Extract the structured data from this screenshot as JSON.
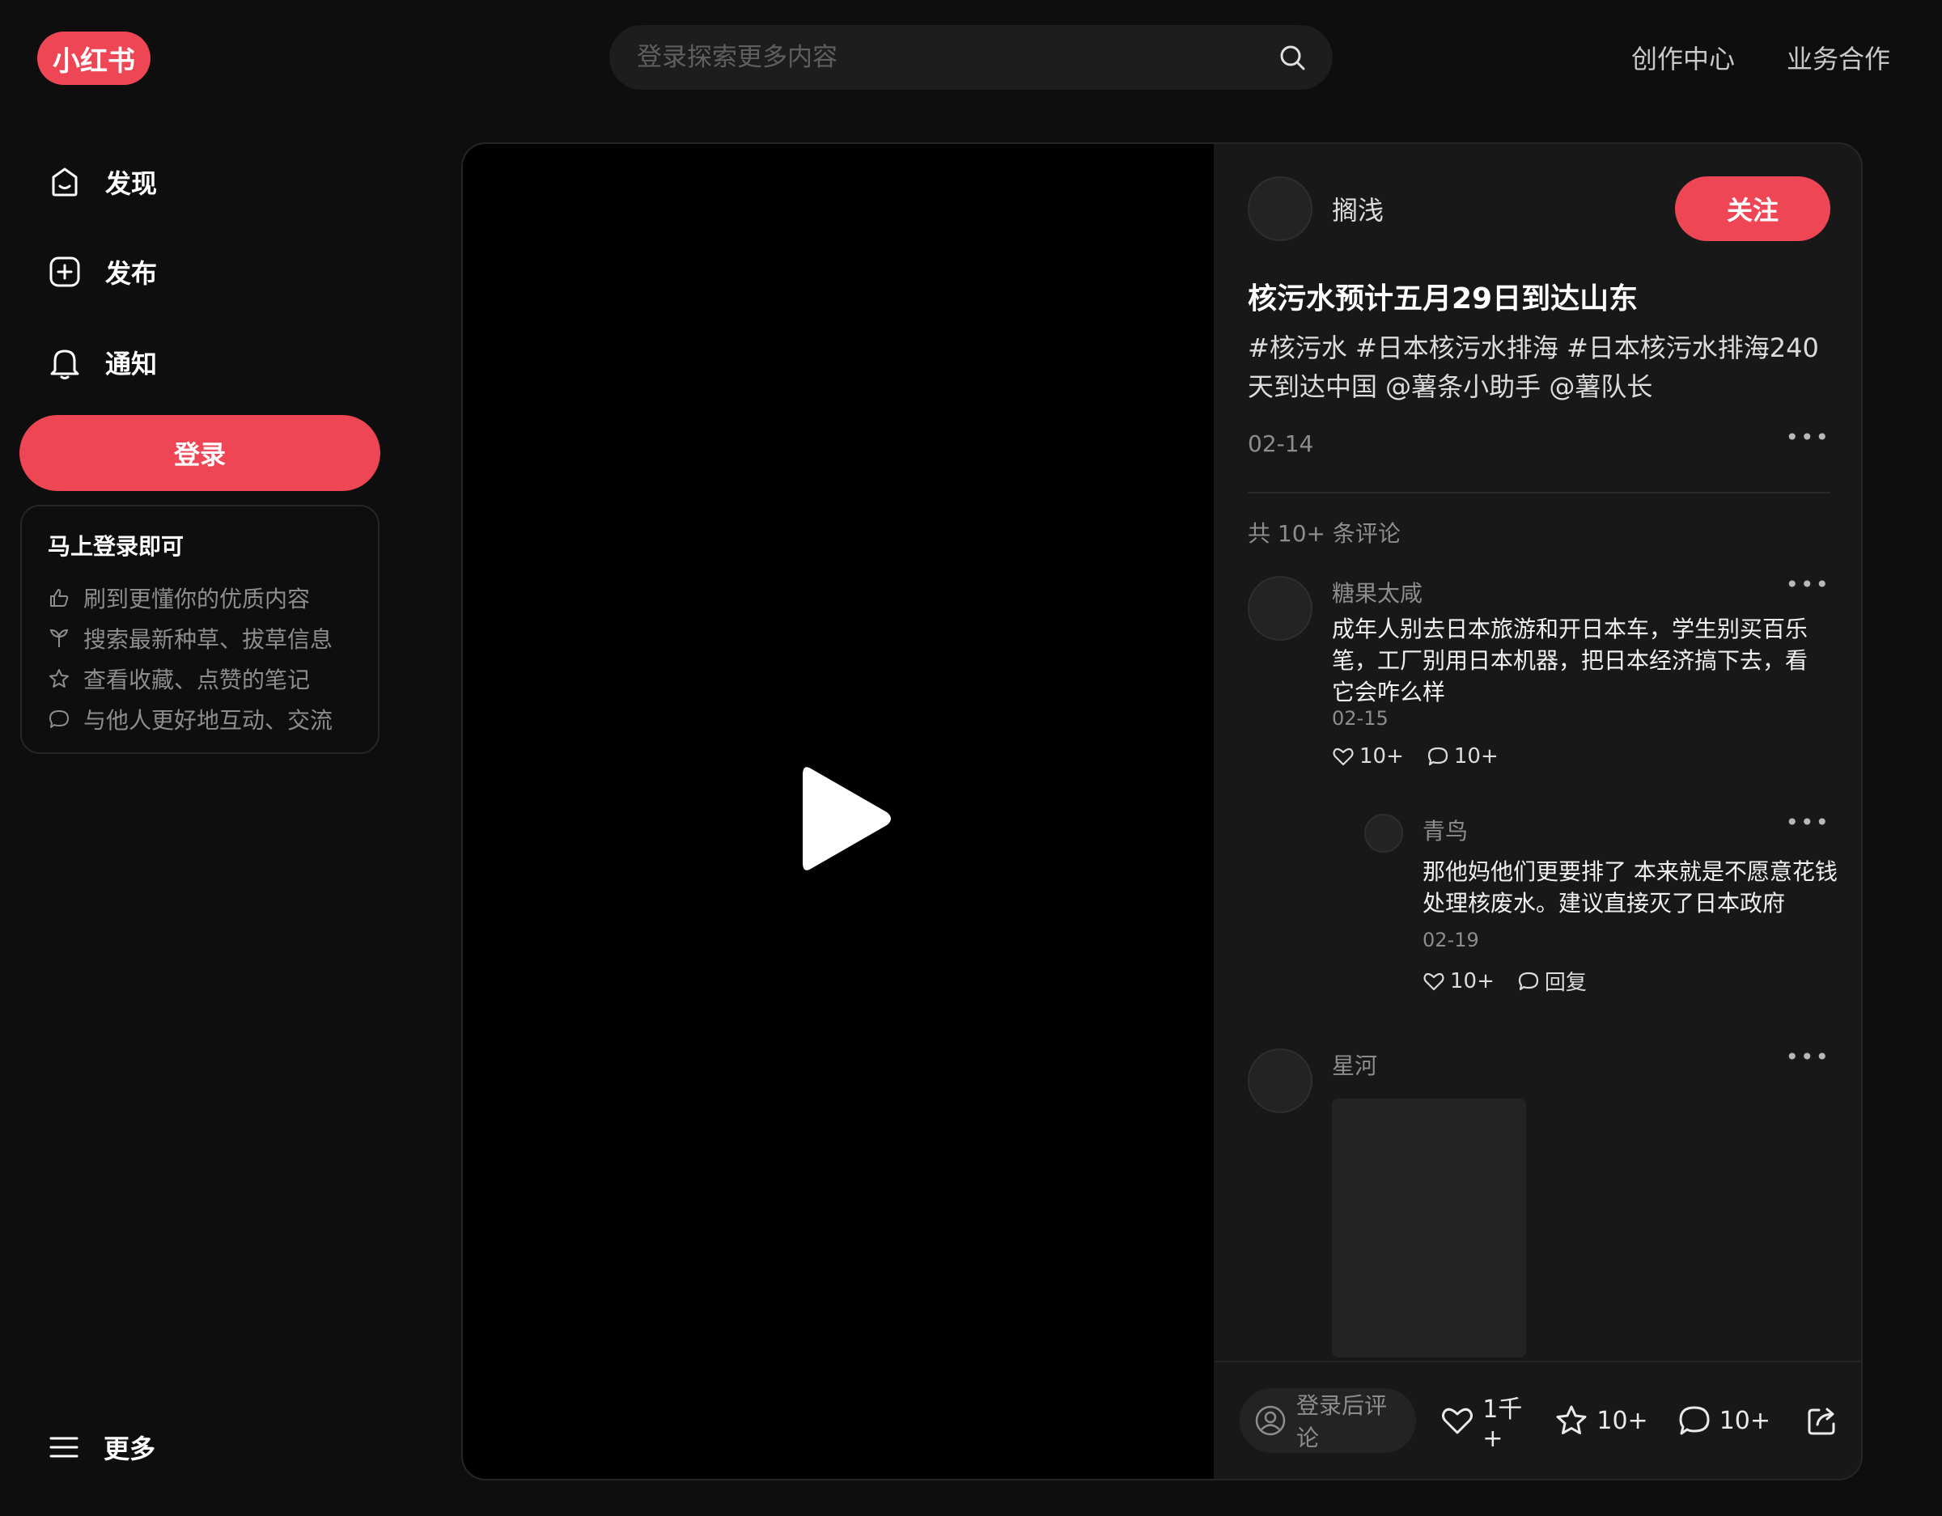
{
  "header": {
    "logo_text": "小红书",
    "search_placeholder": "登录探索更多内容",
    "links": [
      "创作中心",
      "业务合作"
    ]
  },
  "sidebar": {
    "items": [
      {
        "label": "发现",
        "icon": "discover-icon"
      },
      {
        "label": "发布",
        "icon": "publish-icon"
      },
      {
        "label": "通知",
        "icon": "bell-icon"
      }
    ],
    "login_button": "登录",
    "login_card": {
      "title": "马上登录即可",
      "rows": [
        {
          "text": "刷到更懂你的优质内容",
          "icon": "thumbs-up-icon"
        },
        {
          "text": "搜索最新种草、拔草信息",
          "icon": "sprout-icon"
        },
        {
          "text": "查看收藏、点赞的笔记",
          "icon": "star-icon"
        },
        {
          "text": "与他人更好地互动、交流",
          "icon": "chat-bubble-icon"
        }
      ]
    },
    "more_label": "更多"
  },
  "note": {
    "author": "搁浅",
    "follow_label": "关注",
    "title": "核污水预计五月29日到达山东",
    "description": "#核污水 #日本核污水排海 #日本核污水排海240天到达中国 @薯条小助手 @薯队长",
    "date": "02-14",
    "comment_count": "共 10+ 条评论",
    "comments": [
      {
        "name": "糖果太咸",
        "text": "成年人别去日本旅游和开日本车，学生别买百乐笔，工厂别用日本机器，把日本经济搞下去，看它会咋么样",
        "date": "02-15",
        "likes": "10+",
        "replies": "10+",
        "reply": {
          "name": "青鸟",
          "text": "那他妈他们更要排了 本来就是不愿意花钱处理核废水。建议直接灭了日本政府",
          "date": "02-19",
          "likes": "10+",
          "reply_label": "回复"
        }
      },
      {
        "name": "星河"
      }
    ],
    "bottom_bar": {
      "comment_placeholder": "登录后评论",
      "likes": "1千+",
      "collects": "10+",
      "comments": "10+"
    }
  },
  "colors": {
    "brand": "#ef4655",
    "background": "#0e0e0e",
    "panel": "#181818"
  }
}
